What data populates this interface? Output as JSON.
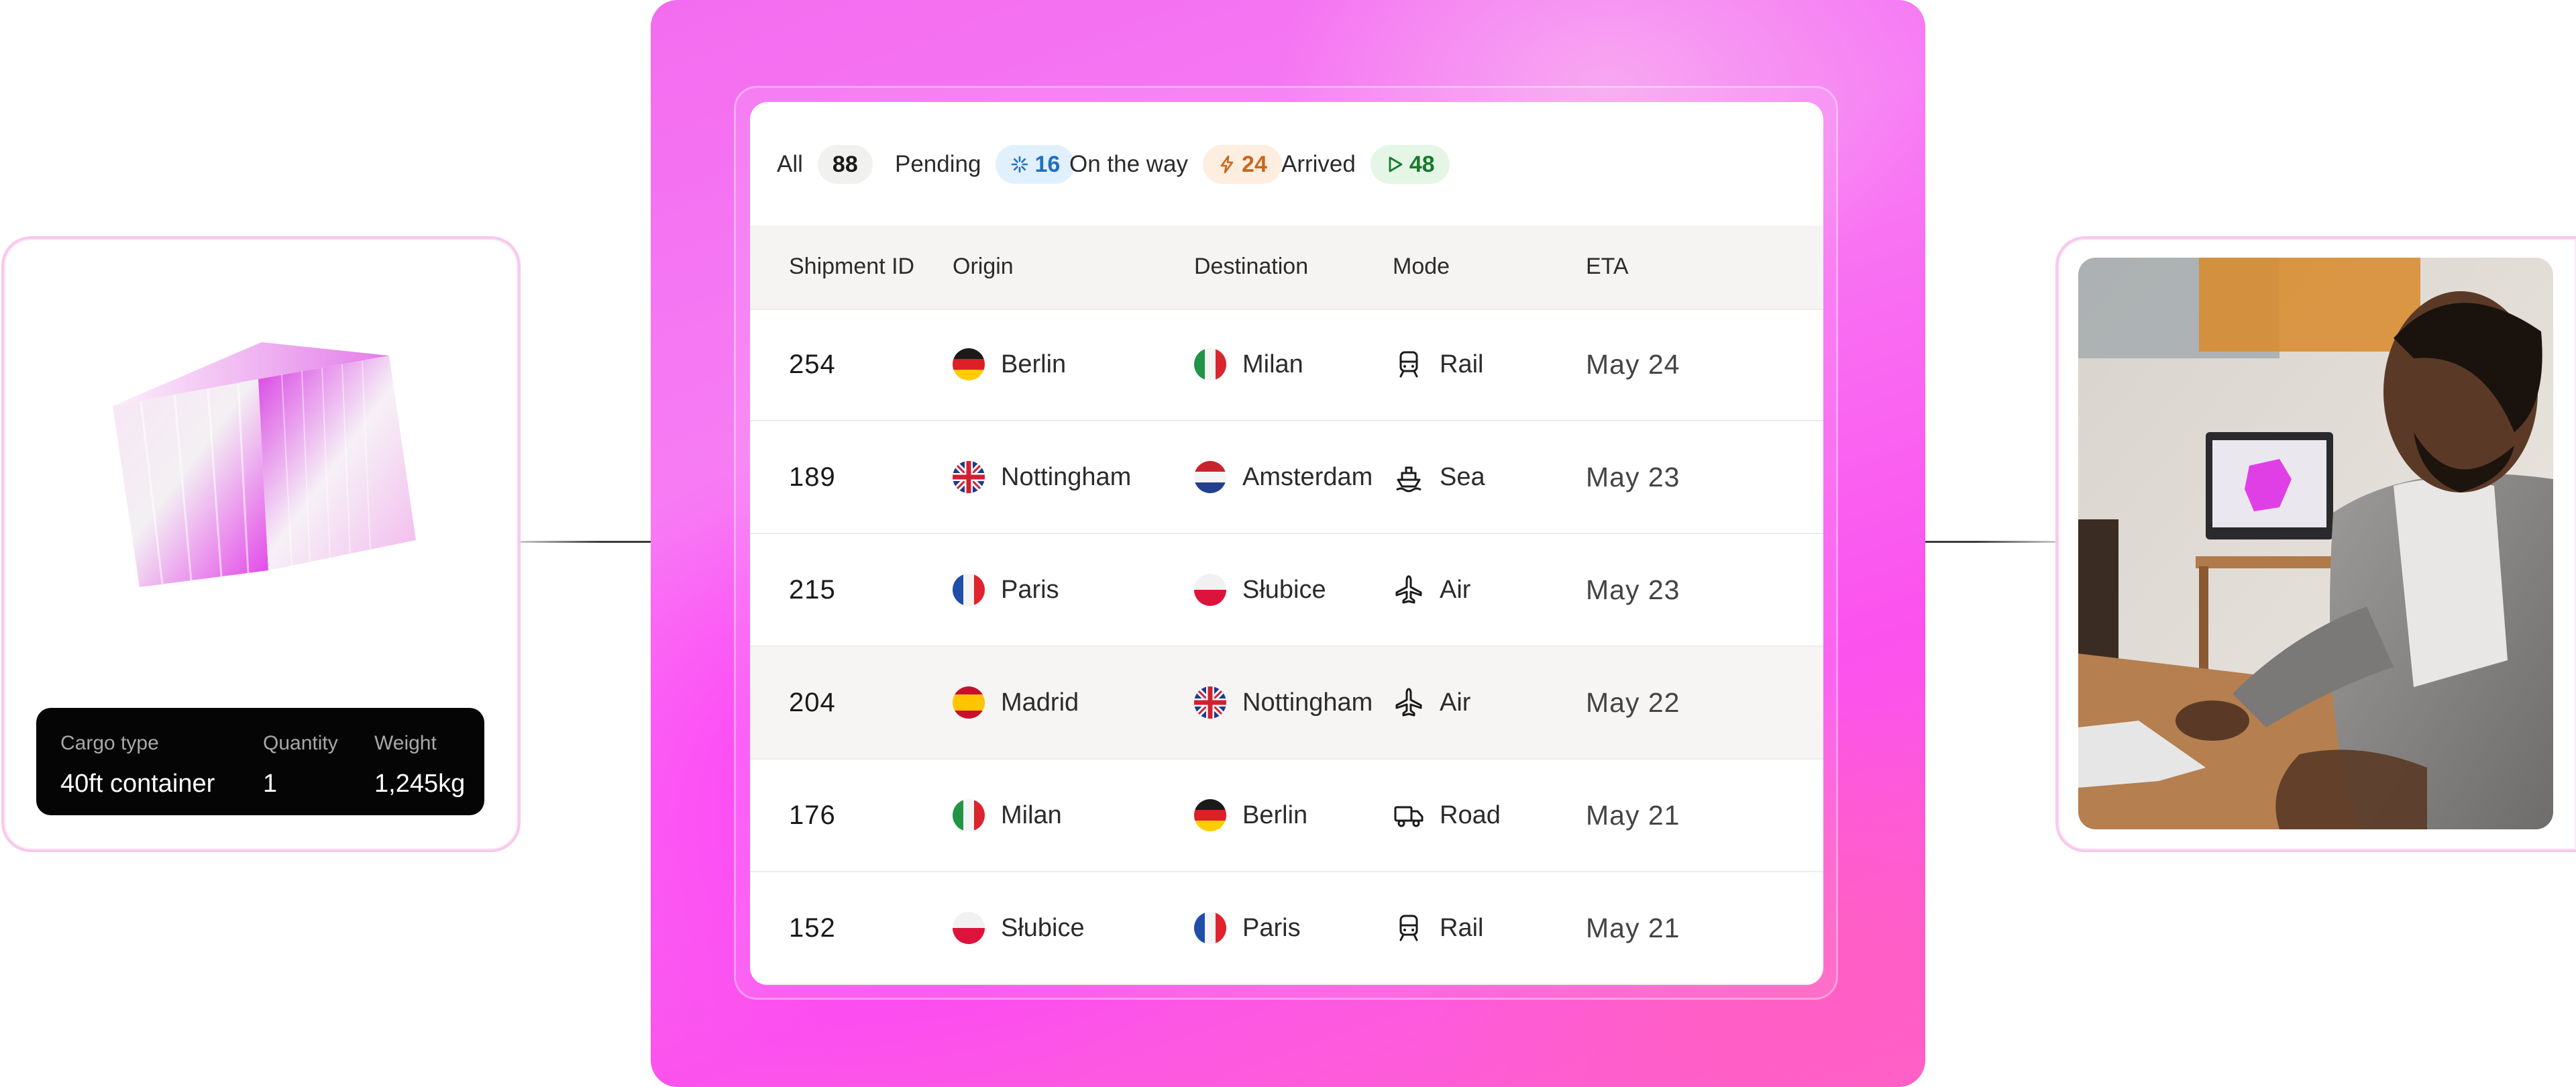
{
  "cargo": {
    "labels": {
      "type": "Cargo type",
      "quantity": "Quantity",
      "weight": "Weight"
    },
    "values": {
      "type": "40ft container",
      "quantity": "1",
      "weight": "1,245kg"
    }
  },
  "filters": [
    {
      "label": "All",
      "count": "88",
      "icon": "none",
      "badge_bg": "#f1f1ef",
      "badge_fg": "#1a1a1a"
    },
    {
      "label": "Pending",
      "count": "16",
      "icon": "spinner-icon",
      "badge_bg": "#e1f0fd",
      "badge_fg": "#1f6fc4"
    },
    {
      "label": "On the way",
      "count": "24",
      "icon": "lightning-icon",
      "badge_bg": "#fdeee0",
      "badge_fg": "#c9661c"
    },
    {
      "label": "Arrived",
      "count": "48",
      "icon": "play-icon",
      "badge_bg": "#e5f6e6",
      "badge_fg": "#177a2c"
    }
  ],
  "columns": [
    "Shipment ID",
    "Origin",
    "Destination",
    "Mode",
    "ETA"
  ],
  "rows": [
    {
      "id": "254",
      "origin": "Berlin",
      "origin_flag": "de",
      "destination": "Milan",
      "destination_flag": "it",
      "mode": "Rail",
      "mode_icon": "train-icon",
      "eta": "May 24"
    },
    {
      "id": "189",
      "origin": "Nottingham",
      "origin_flag": "gb",
      "destination": "Amsterdam",
      "destination_flag": "nl",
      "mode": "Sea",
      "mode_icon": "ship-icon",
      "eta": "May 23"
    },
    {
      "id": "215",
      "origin": "Paris",
      "origin_flag": "fr",
      "destination": "Słubice",
      "destination_flag": "pl",
      "mode": "Air",
      "mode_icon": "plane-icon",
      "eta": "May 23"
    },
    {
      "id": "204",
      "origin": "Madrid",
      "origin_flag": "es",
      "destination": "Nottingham",
      "destination_flag": "gb",
      "mode": "Air",
      "mode_icon": "plane-icon",
      "eta": "May 22"
    },
    {
      "id": "176",
      "origin": "Milan",
      "origin_flag": "it",
      "destination": "Berlin",
      "destination_flag": "de",
      "mode": "Road",
      "mode_icon": "truck-icon",
      "eta": "May 21"
    },
    {
      "id": "152",
      "origin": "Słubice",
      "origin_flag": "pl",
      "destination": "Paris",
      "destination_flag": "fr",
      "mode": "Rail",
      "mode_icon": "train-icon",
      "eta": "May 21"
    }
  ],
  "highlighted_row": 3
}
